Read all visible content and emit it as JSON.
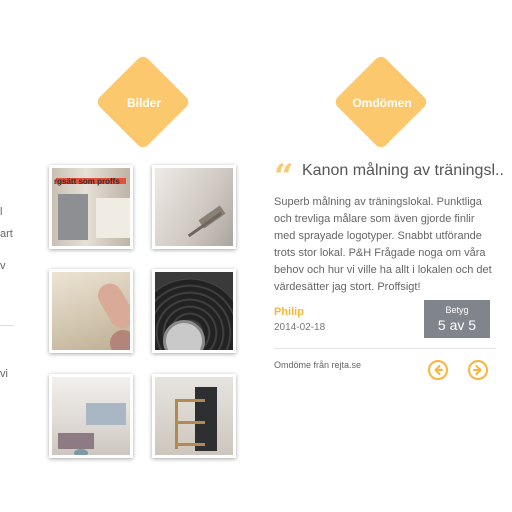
{
  "left_fragments": [
    "l",
    "art",
    "v",
    "vi"
  ],
  "sections": {
    "gallery_label": "Bilder",
    "reviews_label": "Omdömen"
  },
  "gallery": {
    "photos": [
      {
        "caption": "rgsätt som proffs"
      },
      {
        "caption": ""
      },
      {
        "caption": ""
      },
      {
        "caption": ""
      },
      {
        "caption": ""
      },
      {
        "caption": ""
      }
    ]
  },
  "review": {
    "title": "Kanon målning av träningsl..",
    "body": "Superb målning av träningslokal. Punktliga och trevliga målare som även gjorde finlir med sprayade logotyper. Snabbt utförande trots stor lokal. P&H Frågade noga om våra behov och hur vi ville ha allt i lokalen och det värdesätter jag stort. Proffsigt!",
    "author": "Philip",
    "date": "2014-02-18",
    "rating_label": "Betyg",
    "rating_value": "5 av 5",
    "source": "Omdöme från rejta.se"
  },
  "colors": {
    "accent": "#fcc86e",
    "accent_dark": "#fcb43a",
    "rating_bg": "#80858b"
  },
  "icons": {
    "prev": "arrow-left-icon",
    "next": "arrow-right-icon",
    "quote": "quote-icon"
  }
}
